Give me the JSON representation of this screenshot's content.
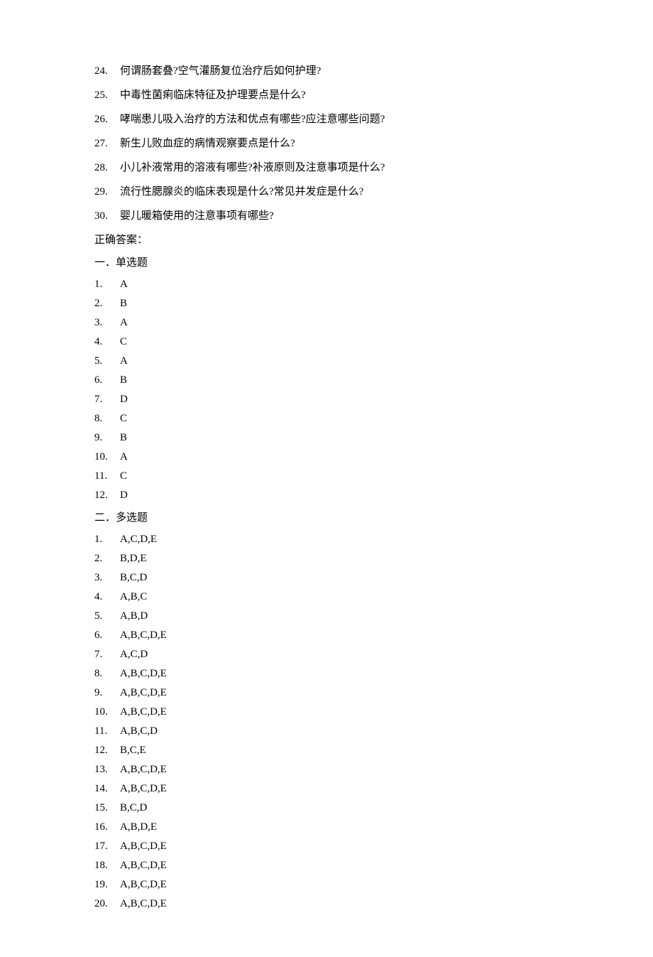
{
  "questions": [
    {
      "num": "24.",
      "text": "何谓肠套叠?空气灌肠复位治疗后如何护理?"
    },
    {
      "num": "25.",
      "text": "中毒性菌痢临床特征及护理要点是什么?"
    },
    {
      "num": "26.",
      "text": "哮喘患儿吸入治疗的方法和优点有哪些?应注意哪些问题?"
    },
    {
      "num": "27.",
      "text": "新生儿败血症的病情观察要点是什么?"
    },
    {
      "num": "28.",
      "text": "小儿补液常用的溶液有哪些?补液原则及注意事项是什么?"
    },
    {
      "num": "29.",
      "text": "流行性腮腺炎的临床表现是什么?常见并发症是什么?"
    },
    {
      "num": "30.",
      "text": "婴儿暖箱使用的注意事项有哪些?"
    }
  ],
  "answerKeyLabel": "正确答案：",
  "section1": {
    "heading": "一．单选题",
    "answers": [
      {
        "num": "1.",
        "val": "A"
      },
      {
        "num": "2.",
        "val": "B"
      },
      {
        "num": "3.",
        "val": "A"
      },
      {
        "num": "4.",
        "val": "C"
      },
      {
        "num": "5.",
        "val": "A"
      },
      {
        "num": "6.",
        "val": "B"
      },
      {
        "num": "7.",
        "val": "D"
      },
      {
        "num": "8.",
        "val": "C"
      },
      {
        "num": "9.",
        "val": "B"
      },
      {
        "num": "10.",
        "val": "A"
      },
      {
        "num": "11.",
        "val": "C"
      },
      {
        "num": "12.",
        "val": "D"
      }
    ]
  },
  "section2": {
    "heading": "二．多选题",
    "answers": [
      {
        "num": "1.",
        "val": "A,C,D,E"
      },
      {
        "num": "2.",
        "val": "B,D,E"
      },
      {
        "num": "3.",
        "val": "B,C,D"
      },
      {
        "num": "4.",
        "val": "A,B,C"
      },
      {
        "num": "5.",
        "val": "A,B,D"
      },
      {
        "num": "6.",
        "val": "A,B,C,D,E"
      },
      {
        "num": "7.",
        "val": "A,C,D"
      },
      {
        "num": "8.",
        "val": "A,B,C,D,E"
      },
      {
        "num": "9.",
        "val": "A,B,C,D,E"
      },
      {
        "num": "10.",
        "val": "A,B,C,D,E"
      },
      {
        "num": "11.",
        "val": "A,B,C,D"
      },
      {
        "num": "12.",
        "val": "B,C,E"
      },
      {
        "num": "13.",
        "val": "A,B,C,D,E"
      },
      {
        "num": "14.",
        "val": "A,B,C,D,E"
      },
      {
        "num": "15.",
        "val": "B,C,D"
      },
      {
        "num": "16.",
        "val": "A,B,D,E"
      },
      {
        "num": "17.",
        "val": "A,B,C,D,E"
      },
      {
        "num": "18.",
        "val": "A,B,C,D,E"
      },
      {
        "num": "19.",
        "val": "A,B,C,D,E"
      },
      {
        "num": "20.",
        "val": "A,B,C,D,E"
      }
    ]
  }
}
